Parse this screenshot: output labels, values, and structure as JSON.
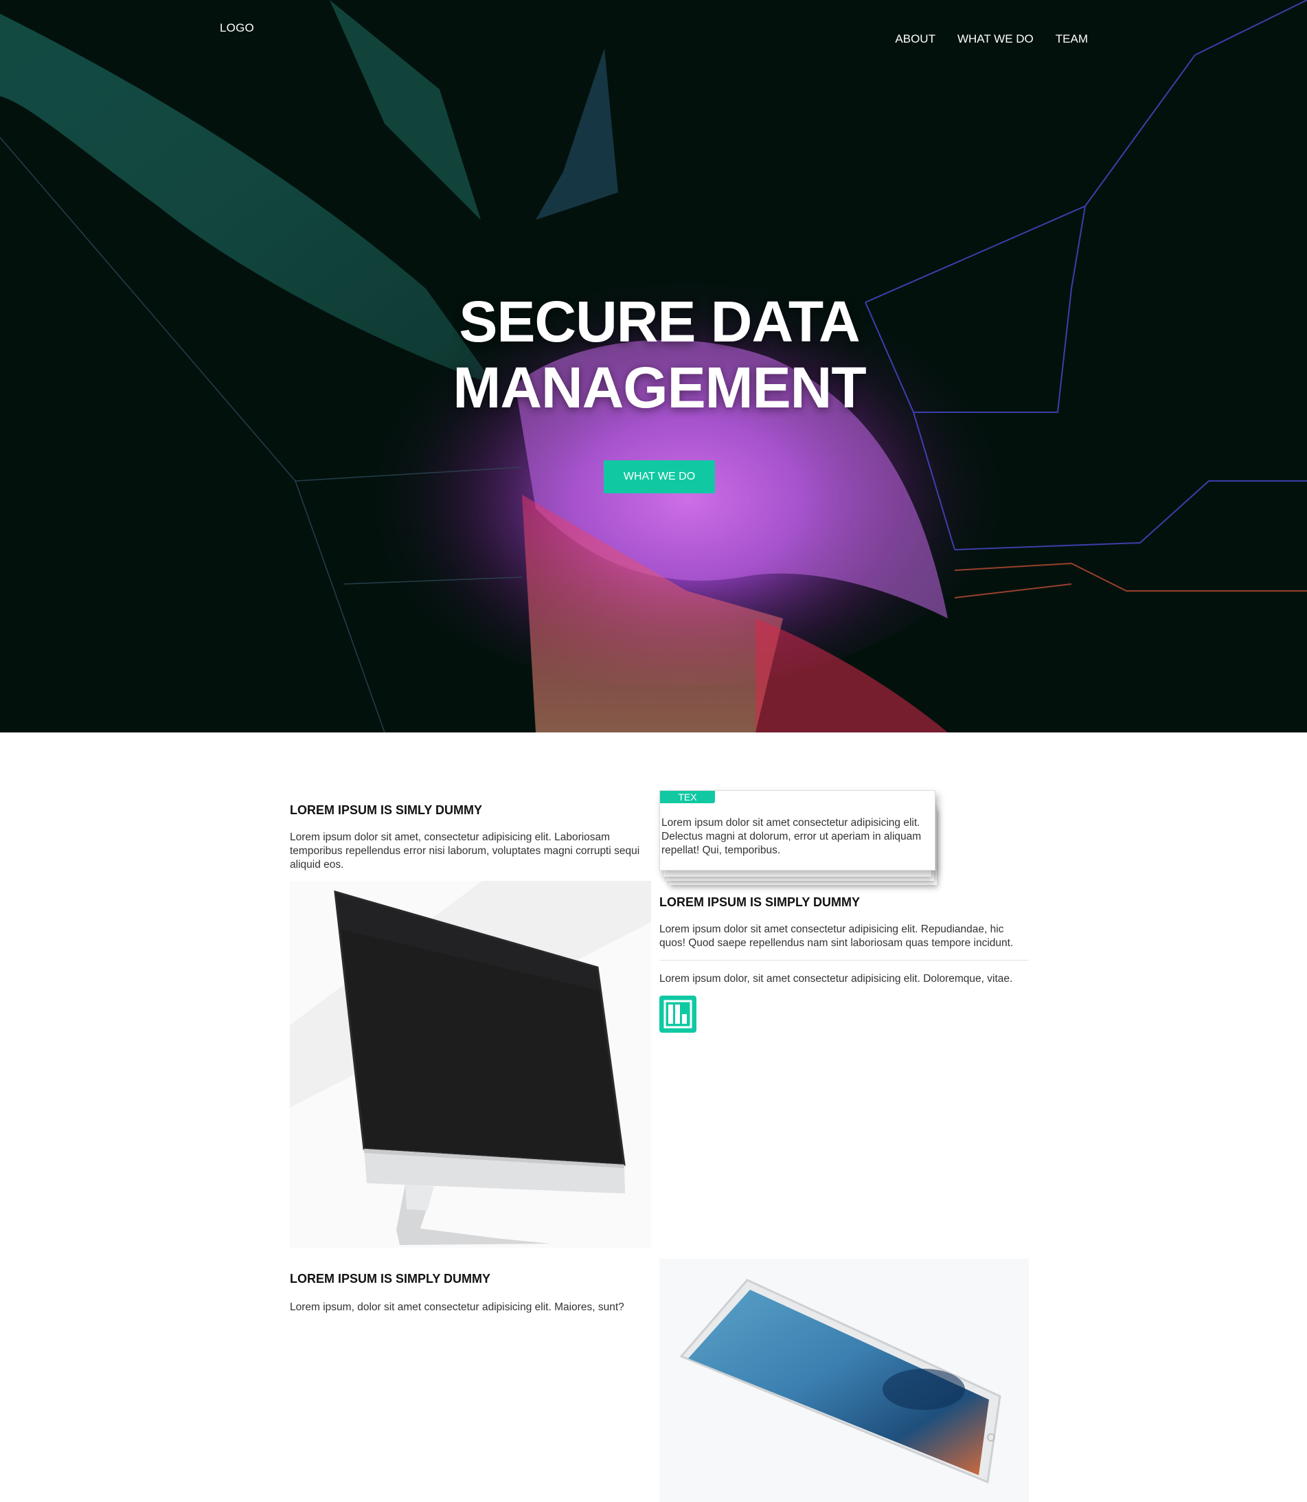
{
  "header": {
    "logo": "LOGO",
    "nav": [
      "ABOUT",
      "WHAT WE DO",
      "TEAM"
    ]
  },
  "hero": {
    "title_line1": "SECURE DATA",
    "title_line2": "MANAGEMENT",
    "button": "WHAT WE DO"
  },
  "section1": {
    "heading": "LOREM IPSUM IS SIMLY DUMMY",
    "body": "Lorem ipsum dolor sit amet, consectetur adipisicing elit. Laboriosam temporibus repellendus error nisi laborum, voluptates magni corrupti sequi aliquid eos."
  },
  "card": {
    "tag": "TEX",
    "body": "Lorem ipsum dolor sit amet consectetur adipisicing elit. Delectus magni at dolorum, error ut aperiam in aliquam repellat! Qui, temporibus."
  },
  "section2": {
    "heading": "LOREM IPSUM IS SIMPLY DUMMY",
    "body": "Lorem ipsum dolor sit amet consectetur adipisicing elit. Repudiandae, hic quos! Quod saepe repellendus nam sint laboriosam quas tempore incidunt.",
    "body2": "Lorem ipsum dolor, sit amet consectetur adipisicing elit. Doloremque, vitae."
  },
  "section3": {
    "heading": "LOREM IPSUM IS SIMPLY DUMMY",
    "body": "Lorem ipsum, dolor sit amet consectetur adipisicing elit. Maiores, sunt?"
  },
  "colors": {
    "accent": "#10c9a3",
    "hero_bg": "#03110d"
  },
  "icons": [
    "bar-chart-icon"
  ]
}
